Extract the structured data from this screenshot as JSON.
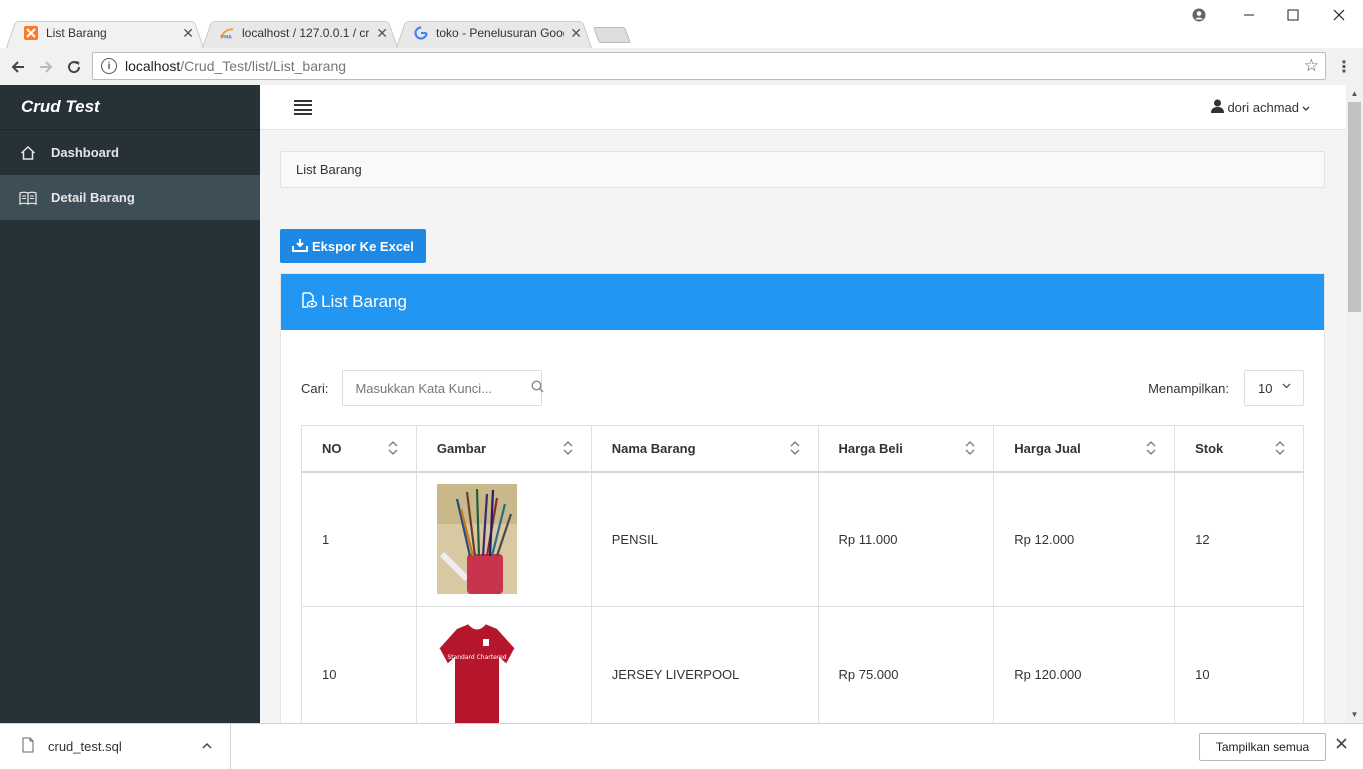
{
  "browser": {
    "tabs": [
      {
        "title": "List Barang",
        "favicon": "xampp-icon",
        "active": true
      },
      {
        "title": "localhost / 127.0.0.1 / cru",
        "favicon": "phpmyadmin-icon",
        "active": false
      },
      {
        "title": "toko - Penelusuran Goog",
        "favicon": "google-icon",
        "active": false
      }
    ],
    "url_host": "localhost",
    "url_path": "/Crud_Test/list/List_barang"
  },
  "sidebar": {
    "brand": "Crud Test",
    "items": [
      {
        "label": "Dashboard",
        "icon": "home-icon",
        "active": false
      },
      {
        "label": "Detail Barang",
        "icon": "book-icon",
        "active": true
      }
    ]
  },
  "topbar": {
    "user": "dori achmad"
  },
  "breadcrumb": "List Barang",
  "export_button": "Ekspor Ke Excel",
  "card": {
    "title": "List Barang",
    "search_label": "Cari:",
    "search_placeholder": "Masukkan Kata Kunci...",
    "show_label": "Menampilkan:",
    "show_value": "10"
  },
  "table": {
    "headers": [
      "NO",
      "Gambar",
      "Nama Barang",
      "Harga Beli",
      "Harga Jual",
      "Stok"
    ],
    "rows": [
      {
        "no": "1",
        "image": "pencils-in-cup",
        "name": "PENSIL",
        "buy": "Rp 11.000",
        "sell": "Rp 12.000",
        "stock": "12"
      },
      {
        "no": "10",
        "image": "liverpool-jersey",
        "name": "JERSEY LIVERPOOL",
        "buy": "Rp 75.000",
        "sell": "Rp 120.000",
        "stock": "10"
      }
    ]
  },
  "jersey_text": "Standard Chartered",
  "downloads": {
    "file": "crud_test.sql",
    "show_all": "Tampilkan semua"
  },
  "colors": {
    "sidebar": "#263238",
    "sidebar_active": "#3d4e56",
    "primary": "#2196f3",
    "button": "#1e88e5"
  }
}
